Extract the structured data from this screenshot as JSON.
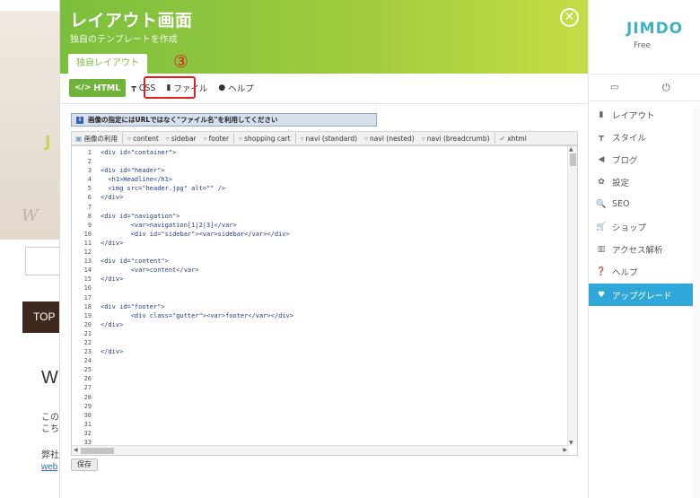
{
  "background": {
    "hero_letter": "J",
    "hero_script": "W",
    "nav_top": "TOP",
    "welcome_initial": "W",
    "text_lines": [
      "この",
      "こち"
    ],
    "company_text": "弊社",
    "link_text": "web"
  },
  "modal": {
    "title": "レイアウト画面",
    "subtitle": "独自のテンプレートを作成",
    "close_icon": "✕",
    "tab_label": "独自レイアウト",
    "annotation": "③",
    "toolbar": {
      "html": "HTML",
      "css": "CSS",
      "file": "ファイル",
      "help": "ヘルプ"
    },
    "info_text": "画像の指定にはURLではなく\"ファイル名\"を利用してください",
    "editor_toolbar": {
      "image_label": "画像の利用",
      "items": [
        "content",
        "sidebar",
        "footer",
        "shopping cart",
        "navi (standard)",
        "navi (nested)",
        "navi (breadcrumb)",
        "xhtml"
      ]
    },
    "code_lines": [
      {
        "n": "1",
        "t": "<div id=\"container\">"
      },
      {
        "n": "2",
        "t": ""
      },
      {
        "n": "3",
        "t": "<div id=\"header\">"
      },
      {
        "n": "4",
        "t": "  <h1>Headline</h1>"
      },
      {
        "n": "5",
        "t": "  <img src=\"header.jpg\" alt=\"\" />"
      },
      {
        "n": "6",
        "t": "</div>"
      },
      {
        "n": "7",
        "t": ""
      },
      {
        "n": "8",
        "t": "<div id=\"navigation\">"
      },
      {
        "n": "9",
        "t": "        <var>navigation[1|2|3]</var>"
      },
      {
        "n": "10",
        "t": "        <div id=\"sidebar\"><var>sidebar</var></div>"
      },
      {
        "n": "11",
        "t": "</div>"
      },
      {
        "n": "12",
        "t": ""
      },
      {
        "n": "13",
        "t": "<div id=\"content\">"
      },
      {
        "n": "14",
        "t": "        <var>content</var>"
      },
      {
        "n": "15",
        "t": "</div>"
      },
      {
        "n": "16",
        "t": ""
      },
      {
        "n": "17",
        "t": ""
      },
      {
        "n": "18",
        "t": "<div id=\"footer\">"
      },
      {
        "n": "19",
        "t": "        <div class=\"gutter\"><var>footer</var></div>"
      },
      {
        "n": "20",
        "t": "</div>"
      },
      {
        "n": "21",
        "t": ""
      },
      {
        "n": "22",
        "t": ""
      },
      {
        "n": "23",
        "t": "</div>"
      },
      {
        "n": "24",
        "t": ""
      },
      {
        "n": "25",
        "t": ""
      },
      {
        "n": "26",
        "t": ""
      },
      {
        "n": "27",
        "t": ""
      },
      {
        "n": "28",
        "t": ""
      },
      {
        "n": "29",
        "t": ""
      },
      {
        "n": "30",
        "t": ""
      },
      {
        "n": "31",
        "t": ""
      },
      {
        "n": "32",
        "t": ""
      },
      {
        "n": "33",
        "t": ""
      }
    ],
    "save_label": "保存"
  },
  "sidebar": {
    "logo": "JIMDO",
    "plan": "Free",
    "top_icons": [
      "monitor-icon",
      "power-icon"
    ],
    "items": [
      {
        "label": "レイアウト",
        "icon": "layout-icon",
        "glyph": "▮"
      },
      {
        "label": "スタイル",
        "icon": "paint-roller-icon",
        "glyph": "┳"
      },
      {
        "label": "ブログ",
        "icon": "megaphone-icon",
        "glyph": "◀"
      },
      {
        "label": "設定",
        "icon": "gear-icon",
        "glyph": "✿"
      },
      {
        "label": "SEO",
        "icon": "search-icon",
        "glyph": "🔍"
      },
      {
        "label": "ショップ",
        "icon": "cart-icon",
        "glyph": "🛒"
      },
      {
        "label": "アクセス解析",
        "icon": "bar-chart-icon",
        "glyph": "▥"
      },
      {
        "label": "ヘルプ",
        "icon": "question-icon",
        "glyph": "❓"
      },
      {
        "label": "アップグレード",
        "icon": "heart-icon",
        "glyph": "♥"
      }
    ],
    "active_index": 8
  },
  "colors": {
    "accent_green": "#7bbf3e",
    "active_blue": "#2fa8d9",
    "annotation_red": "#e02020"
  }
}
